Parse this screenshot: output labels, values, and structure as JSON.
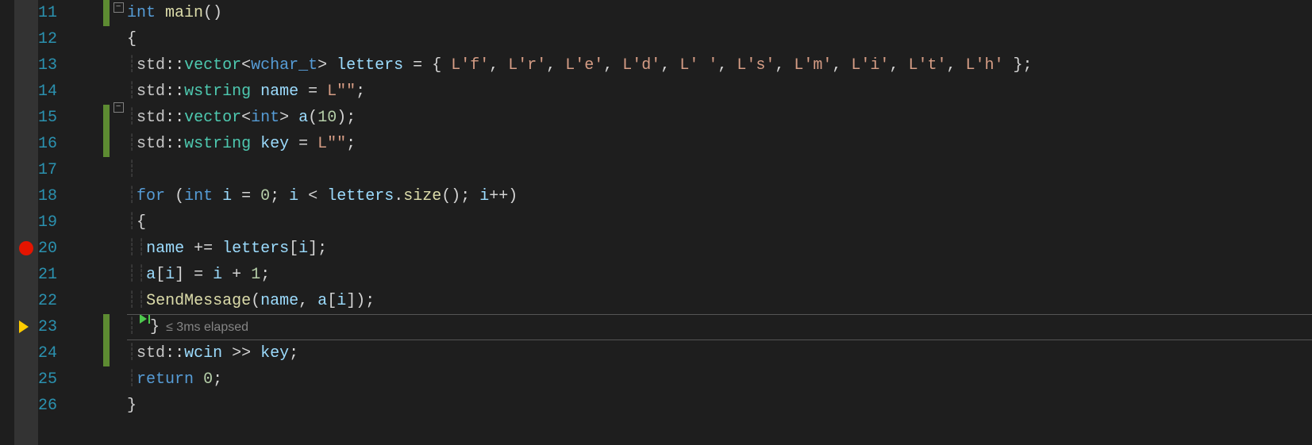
{
  "lines": [
    {
      "n": "11",
      "bp": "",
      "arrow": "",
      "change": true,
      "fold": "minus"
    },
    {
      "n": "12",
      "bp": "",
      "arrow": "",
      "change": false,
      "fold": ""
    },
    {
      "n": "13",
      "bp": "",
      "arrow": "",
      "change": false,
      "fold": ""
    },
    {
      "n": "14",
      "bp": "",
      "arrow": "",
      "change": false,
      "fold": ""
    },
    {
      "n": "15",
      "bp": "",
      "arrow": "",
      "change": true,
      "fold": ""
    },
    {
      "n": "16",
      "bp": "",
      "arrow": "",
      "change": true,
      "fold": ""
    },
    {
      "n": "17",
      "bp": "",
      "arrow": "",
      "change": false,
      "fold": ""
    },
    {
      "n": "18",
      "bp": "",
      "arrow": "",
      "change": false,
      "fold": "minus"
    },
    {
      "n": "19",
      "bp": "",
      "arrow": "",
      "change": false,
      "fold": ""
    },
    {
      "n": "20",
      "bp": "dot",
      "arrow": "",
      "change": false,
      "fold": ""
    },
    {
      "n": "21",
      "bp": "",
      "arrow": "",
      "change": false,
      "fold": ""
    },
    {
      "n": "22",
      "bp": "",
      "arrow": "",
      "change": false,
      "fold": ""
    },
    {
      "n": "23",
      "bp": "",
      "arrow": "arrow",
      "change": true,
      "fold": ""
    },
    {
      "n": "24",
      "bp": "",
      "arrow": "",
      "change": true,
      "fold": ""
    },
    {
      "n": "25",
      "bp": "",
      "arrow": "",
      "change": false,
      "fold": ""
    },
    {
      "n": "26",
      "bp": "",
      "arrow": "",
      "change": false,
      "fold": ""
    }
  ],
  "code": {
    "l11": {
      "kw_int": "int",
      "fn_main": "main",
      "paren": "()"
    },
    "l12": {
      "brace": "{"
    },
    "l13": {
      "ns": "std",
      "cc": "::",
      "ty": "vector",
      "lt": "<",
      "ty2": "wchar_t",
      "gt": ">",
      "sp": " ",
      "id": "letters",
      "eq": " = ",
      "ob": "{ ",
      "items": [
        "L'f'",
        "L'r'",
        "L'e'",
        "L'd'",
        "L' '",
        "L's'",
        "L'm'",
        "L'i'",
        "L't'",
        "L'h'"
      ],
      "cb": " };"
    },
    "l14": {
      "ns": "std",
      "cc": "::",
      "ty": "wstring",
      "sp": " ",
      "id": "name",
      "eq": " = ",
      "prefix": "L",
      "lit": "\"\"",
      "end": ";"
    },
    "l15": {
      "ns": "std",
      "cc": "::",
      "ty": "vector",
      "lt": "<",
      "ty2": "int",
      "gt": ">",
      "sp": " ",
      "id": "a",
      "call": "(",
      "arg": "10",
      "cp": ");"
    },
    "l16": {
      "ns": "std",
      "cc": "::",
      "ty": "wstring",
      "sp": " ",
      "id": "key",
      "eq": " = ",
      "prefix": "L",
      "lit": "\"\"",
      "end": ";"
    },
    "l18": {
      "kw_for": "for",
      "sp": " (",
      "kw_int": "int",
      "sp2": " ",
      "id": "i",
      "eq": " = ",
      "z": "0",
      "sc": "; ",
      "id2": "i",
      "lt": " < ",
      "id3": "letters",
      "dot": ".",
      "fn": "size",
      "p": "(); ",
      "id4": "i",
      "pp": "++",
      ")": ")"
    },
    "l19": {
      "brace": "{"
    },
    "l20": {
      "id": "name",
      "op": " += ",
      "id2": "letters",
      "lb": "[",
      "idx": "i",
      "rb": "];"
    },
    "l21": {
      "id": "a",
      "lb": "[",
      "idx": "i",
      "rb": "] = ",
      "idx2": "i",
      "plus": " + ",
      "one": "1",
      "end": ";"
    },
    "l22": {
      "fn": "SendMessage",
      "op": "(",
      "a1": "name",
      "c": ", ",
      "a2": "a",
      "lb": "[",
      "idx": "i",
      "rb": "]);"
    },
    "l23": {
      "brace": "}",
      "perf": "≤ 3ms elapsed"
    },
    "l24": {
      "ns": "std",
      "cc": "::",
      "id": "wcin",
      "op": " >> ",
      "id2": "key",
      "end": ";"
    },
    "l25": {
      "kw": "return",
      "sp": " ",
      "z": "0",
      "end": ";"
    },
    "l26": {
      "brace": "}"
    }
  },
  "highlight_line": "23"
}
